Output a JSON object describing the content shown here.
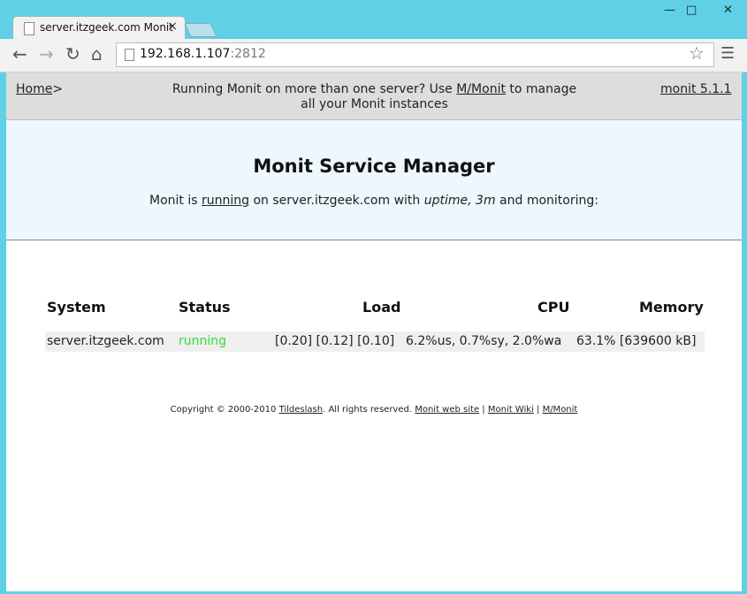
{
  "browser": {
    "tab_title": "server.itzgeek.com Monit",
    "tab_close": "×",
    "url_host": "192.168.1.107",
    "url_port": ":2812",
    "minimize": "—",
    "maximize": "□",
    "close": "✕"
  },
  "header": {
    "home_label": "Home",
    "home_sep": ">",
    "promo_prefix": "Running Monit on more than one server? Use ",
    "promo_link": "M/Monit",
    "promo_suffix": " to manage all your Monit instances",
    "version_link": "monit 5.1.1"
  },
  "banner": {
    "title": "Monit Service Manager",
    "status_prefix": "Monit is ",
    "status_link": "running",
    "status_mid": " on server.itzgeek.com with ",
    "status_uptime": "uptime, 3m",
    "status_suffix": "  and monitoring:"
  },
  "table": {
    "headers": {
      "system": "System",
      "status": "Status",
      "load": "Load",
      "cpu": "CPU",
      "memory": "Memory"
    },
    "rows": [
      {
        "system": "server.itzgeek.com",
        "status": "running",
        "load": "[0.20] [0.12] [0.10]",
        "cpu": "6.2%us, 0.7%sy, 2.0%wa",
        "memory": "63.1% [639600 kB]"
      }
    ]
  },
  "footer": {
    "copyright_prefix": "Copyright © 2000-2010 ",
    "tildeslash": "Tildeslash",
    "copyright_suffix": ". All rights reserved.  ",
    "site_link": "Monit web site",
    "sep": " | ",
    "wiki_link": "Monit Wiki",
    "mmonit_link": "M/Monit"
  },
  "colors": {
    "running": "#33dd33",
    "banner_bg": "#edf7fd",
    "header_bg": "#dddddd"
  },
  "icons": [
    "page-icon",
    "back-icon",
    "forward-icon",
    "reload-icon",
    "home-icon",
    "star-icon",
    "menu-icon"
  ]
}
